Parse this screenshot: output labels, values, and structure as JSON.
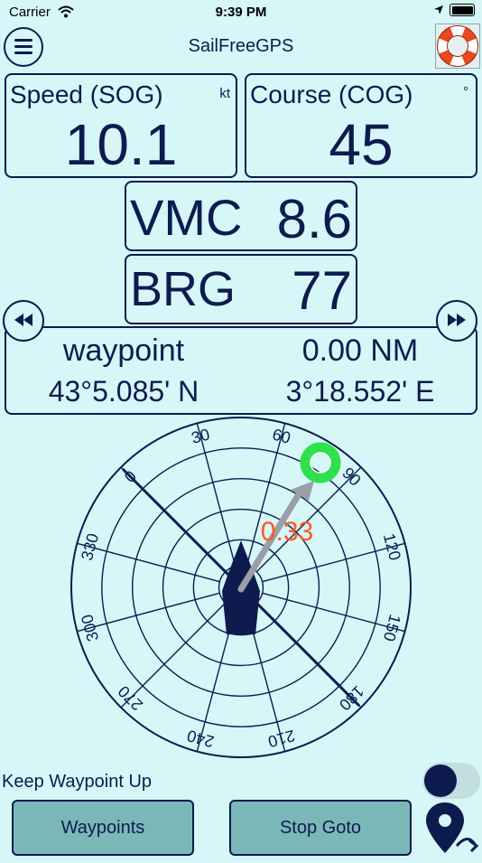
{
  "status_bar": {
    "carrier": "Carrier",
    "time": "9:39 PM"
  },
  "nav": {
    "title": "SailFreeGPS",
    "menu_icon": "hamburger-menu-icon",
    "lifebuoy_icon": "lifebuoy-icon"
  },
  "speed": {
    "label": "Speed (SOG)",
    "unit": "kt",
    "value": "10.1"
  },
  "course": {
    "label": "Course (COG)",
    "unit": "°",
    "value": "45"
  },
  "vmc": {
    "label": "VMC",
    "value": "8.6"
  },
  "brg": {
    "label": "BRG",
    "value": "77"
  },
  "waypoint": {
    "name": "waypoint",
    "distance": "0.00 NM",
    "lat": "43°5.085' N",
    "lon": "3°18.552' E",
    "prev_icon": "rewind-icon",
    "next_icon": "fast-forward-icon"
  },
  "radar": {
    "labels": [
      {
        "text": "0",
        "deg": 0
      },
      {
        "text": "30",
        "deg": 30
      },
      {
        "text": "60",
        "deg": 60
      },
      {
        "text": "90",
        "deg": 90
      },
      {
        "text": "120",
        "deg": 120
      },
      {
        "text": "150",
        "deg": 150
      },
      {
        "text": "180",
        "deg": 180
      },
      {
        "text": "210",
        "deg": 210
      },
      {
        "text": "240",
        "deg": 240
      },
      {
        "text": "270",
        "deg": 270
      },
      {
        "text": "300",
        "deg": 300
      },
      {
        "text": "330",
        "deg": 330
      }
    ],
    "range_value": "0.33",
    "colors": {
      "line": "#0d1b4f",
      "waypoint": "#2fe04d",
      "arrow": "#9a9ea6",
      "range": "#ff5a1f"
    }
  },
  "controls": {
    "keep_waypoint_label": "Keep Waypoint Up",
    "waypoints_button": "Waypoints",
    "stop_goto_button": "Stop Goto",
    "goto_icon": "map-pin-goto-icon"
  }
}
